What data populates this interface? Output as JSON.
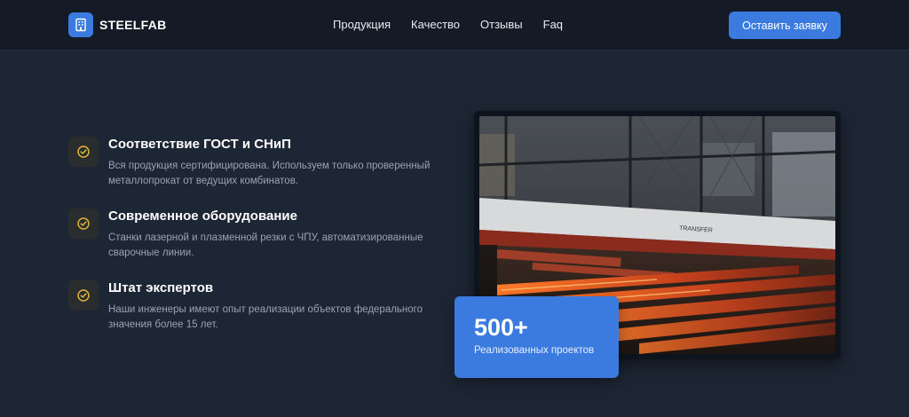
{
  "brand": {
    "name": "STEELFAB",
    "icon": "building-icon",
    "accent": "#3b7be0"
  },
  "nav": {
    "items": [
      {
        "label": "Продукция"
      },
      {
        "label": "Качество"
      },
      {
        "label": "Отзывы"
      },
      {
        "label": "Faq"
      }
    ],
    "cta_label": "Оставить заявку"
  },
  "features": [
    {
      "icon": "check-circle-icon",
      "title": "Соответствие ГОСТ и СНиП",
      "description": "Вся продукция сертифицирована. Используем только проверенный металлопрокат от ведущих комбинатов."
    },
    {
      "icon": "check-circle-icon",
      "title": "Современное оборудование",
      "description": "Станки лазерной и плазменной резки с ЧПУ, автоматизированные сварочные линии."
    },
    {
      "icon": "check-circle-icon",
      "title": "Штат экспертов",
      "description": "Наши инженеры имеют опыт реализации объектов федерального значения более 15 лет."
    }
  ],
  "stats": {
    "value": "500+",
    "label": "Реализованных проектов"
  },
  "photo": {
    "subject": "steel-mill-hot-billets",
    "sign_text": "TRANSFER"
  },
  "colors": {
    "icon_check": "#e3b23c",
    "background": "#1d2634",
    "header": "#141b26"
  }
}
